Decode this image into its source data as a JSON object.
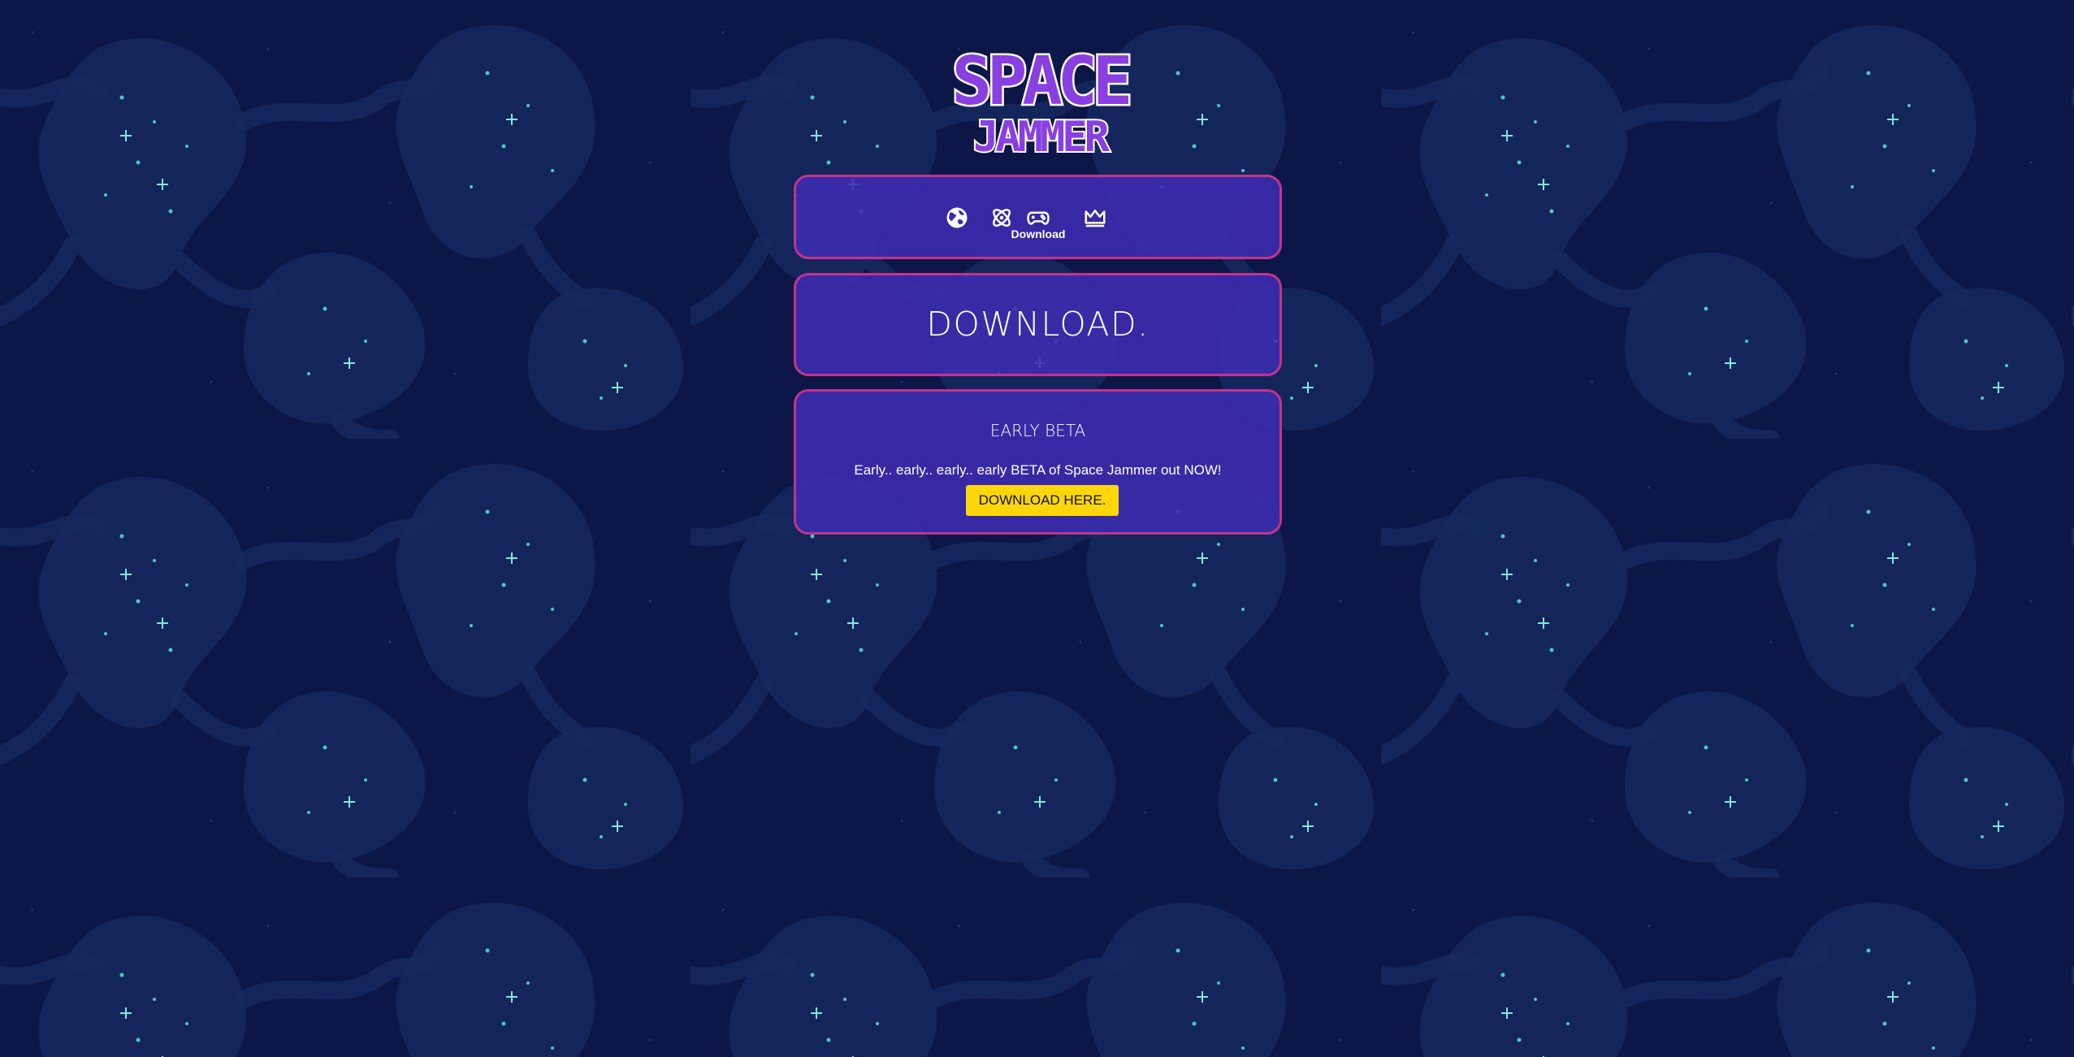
{
  "logo": {
    "line1": "SPACE",
    "line2": "JAMMER"
  },
  "nav": {
    "items": [
      {
        "icon": "globe-icon",
        "label": ""
      },
      {
        "icon": "atom-icon",
        "label": ""
      },
      {
        "icon": "gamepad-icon",
        "label": "Download"
      },
      {
        "icon": "crown-icon",
        "label": ""
      }
    ],
    "active_label": "Download"
  },
  "header": {
    "title": "DOWNLOAD."
  },
  "beta": {
    "title": "EARLY BETA",
    "text": "Early.. early.. early.. early BETA of Space Jammer out NOW!",
    "button_label": "DOWNLOAD HERE."
  },
  "colors": {
    "background": "#0c1748",
    "panel": "#3e2cb0",
    "panel_border": "#c0348e",
    "button": "#ffd60a",
    "stars": "#6fe0d6"
  }
}
